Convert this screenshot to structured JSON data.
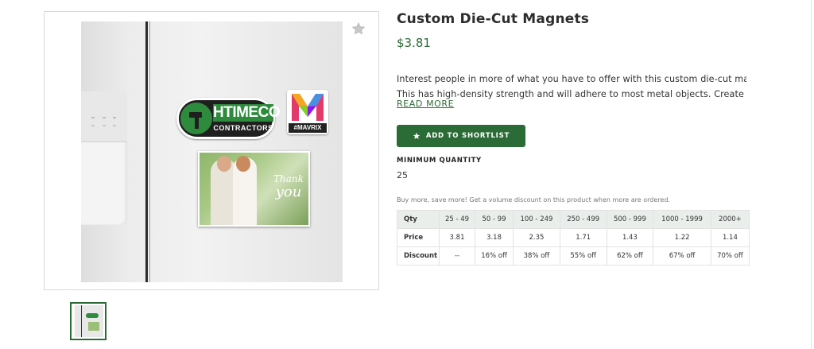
{
  "product": {
    "title": "Custom Die-Cut Magnets",
    "price": "$3.81",
    "description_lines": [
      "Interest people in more of what you have to offer with this custom die-cut magnet!",
      "This has high-density strength and will adhere to most metal objects. Create custo…"
    ],
    "read_more": "READ MORE",
    "add_to_shortlist": "ADD TO SHORTLIST",
    "min_quantity_label": "MINIMUM QUANTITY",
    "min_quantity_value": "25",
    "volume_note": "Buy more, save more! Get a volume discount on this product when more are ordered."
  },
  "image": {
    "magnet_logo_text_1": "HTIMECO",
    "magnet_logo_text_2": "CONTRACTORS",
    "magnet_mavrix_text": "#MAVRIX",
    "photo_text_1": "Thank",
    "photo_text_2": "you",
    "favorite_icon": "star-outline-icon"
  },
  "pricing_table": {
    "header": [
      "Qty",
      "25 - 49",
      "50 - 99",
      "100 - 249",
      "250 - 499",
      "500 - 999",
      "1000 - 1999",
      "2000+"
    ],
    "rows": [
      [
        "Price",
        "3.81",
        "3.18",
        "2.35",
        "1.71",
        "1.43",
        "1.22",
        "1.14"
      ],
      [
        "Discount",
        "--",
        "16% off",
        "38% off",
        "55% off",
        "62% off",
        "67% off",
        "70% off"
      ]
    ]
  },
  "colors": {
    "brand_green": "#2b6b35",
    "table_header_bg": "#e9eeeb"
  }
}
